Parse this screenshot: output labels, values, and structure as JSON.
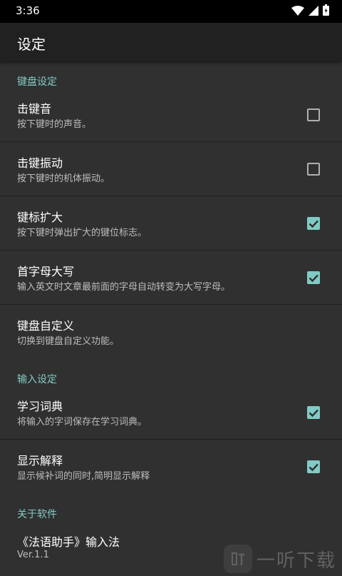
{
  "status_bar": {
    "time": "3:36",
    "icons": [
      "wifi-icon",
      "signal-icon",
      "battery-icon"
    ]
  },
  "app_bar": {
    "title": "设定"
  },
  "colors": {
    "accent": "#80cbc4",
    "background": "#303030",
    "app_bar": "#212121",
    "status_bar": "#000000"
  },
  "sections": {
    "keyboard": {
      "header": "键盘设定",
      "items": [
        {
          "title": "击键音",
          "summary": "按下键时的声音。",
          "checked": false
        },
        {
          "title": "击键振动",
          "summary": "按下键时的机体振动。",
          "checked": false
        },
        {
          "title": "键标扩大",
          "summary": "按下键时弹出扩大的键位标志。",
          "checked": true
        },
        {
          "title": "首字母大写",
          "summary": "输入英文时文章最前面的字母自动转变为大写字母。",
          "checked": true
        },
        {
          "title": "键盘自定义",
          "summary": "切换到键盘自定义功能。"
        }
      ]
    },
    "input": {
      "header": "输入设定",
      "items": [
        {
          "title": "学习词典",
          "summary": "将输入的字词保存在学习词典。",
          "checked": true
        },
        {
          "title": "显示解释",
          "summary": "显示候补词的同时,简明显示解释",
          "checked": true
        }
      ]
    },
    "about": {
      "header": "关于软件",
      "items": [
        {
          "title": "《法语助手》输入法",
          "summary": "Ver.1.1"
        }
      ]
    }
  },
  "watermark": {
    "text": "一听下载"
  }
}
